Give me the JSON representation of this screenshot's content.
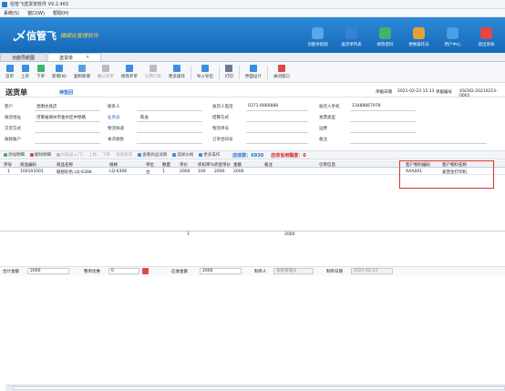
{
  "window": {
    "title": "信管飞送货单软件 V9.2.463"
  },
  "menu": [
    "系统(S)",
    "窗口(W)",
    "帮助(H)"
  ],
  "banner": {
    "mark": "乄",
    "brand": "信管飞",
    "slogan": "精细化管理软件"
  },
  "nav": [
    {
      "label": "功能导航图",
      "color": "#5aa6e6"
    },
    {
      "label": "送货单列表",
      "color": "#3b7fd8"
    },
    {
      "label": "修改密码",
      "color": "#3fb56a"
    },
    {
      "label": "更换操作员",
      "color": "#e2a23a"
    },
    {
      "label": "用户中心",
      "color": "#4aa0e8"
    },
    {
      "label": "退出系统",
      "color": "#e04848"
    }
  ],
  "tabs": {
    "home": "功能导航图",
    "current": "送货单",
    "close": "×"
  },
  "toolbar": {
    "first": "首单",
    "prev": "上单",
    "next": "下单",
    "new": "新增(N)",
    "edit": "复制新增",
    "save": "确认开单",
    "approve": "修改开单",
    "import_order": "引用订单",
    "more": "更多操作",
    "import": "导入导出",
    "print": "打印",
    "layout": "界面设计",
    "close": "关闭窗口"
  },
  "form": {
    "title": "送货单",
    "subtitle": "待签回",
    "date_label": "单据日期",
    "date": "2021-02-23 15.13",
    "no_label": "单据编号",
    "no": "XSCKD-20210223-0001",
    "customer_label": "客户",
    "customer": "昆明文具店",
    "address_label": "收货地址",
    "address": "河南省郑州市金水区中原路",
    "pay_label": "交货方式",
    "cust_no_label": "收款账户",
    "contact_label": "联系人",
    "clerk_label": "业务员",
    "clerk": "陈总",
    "logistics_label": "物流快递",
    "amount_label": "本次收款",
    "phone_label": "收货人电话",
    "phone": "0371-6666888",
    "settle_label": "结算方式",
    "logno_label": "物流单号",
    "orderno_label": "订单合同号",
    "mobile_label": "收货人手机",
    "mobile": "13488667978",
    "invoice_label": "发票类型",
    "freight_label": "运费",
    "note_label": "备注"
  },
  "gridbar": {
    "add": "添加明细",
    "del": "删除明细",
    "scan": "扫描录入(T)",
    "sort": "快速排序",
    "up": "上移",
    "down": "下移",
    "quick": "快速排序",
    "query": "查看商品详情",
    "select": "选择价格",
    "more": "更多操作",
    "arrears_label": "应收款：",
    "arrears": "6930",
    "credit_label": "应收信用额度：",
    "credit": "0"
  },
  "grid": {
    "headers": [
      "序号",
      "商品编码",
      "商品名称",
      "规格",
      "单位",
      "数量",
      "单价",
      "折扣率%",
      "折后单价",
      "金额",
      "备注",
      "引单信息",
      "客户物料编码",
      "客户物料名称"
    ],
    "rows": [
      [
        "1",
        "100101001",
        "联想彩色 LQ-630K",
        "LQ-630K",
        "台",
        "1",
        "2000",
        "100",
        "2000",
        "2000",
        "",
        "",
        "AAA001",
        "爱普生打印机"
      ]
    ],
    "totals": {
      "qty": "1",
      "amount": "2000"
    }
  },
  "footer": {
    "total_label": "合计金额",
    "total": "2000",
    "discount_label": "整单优惠",
    "discount": "0",
    "receivable_label": "应收金额",
    "receivable": "2000",
    "maker_label": "制单人",
    "maker": "系统管理员",
    "made_label": "制单日期",
    "made": "2021-02-23"
  }
}
